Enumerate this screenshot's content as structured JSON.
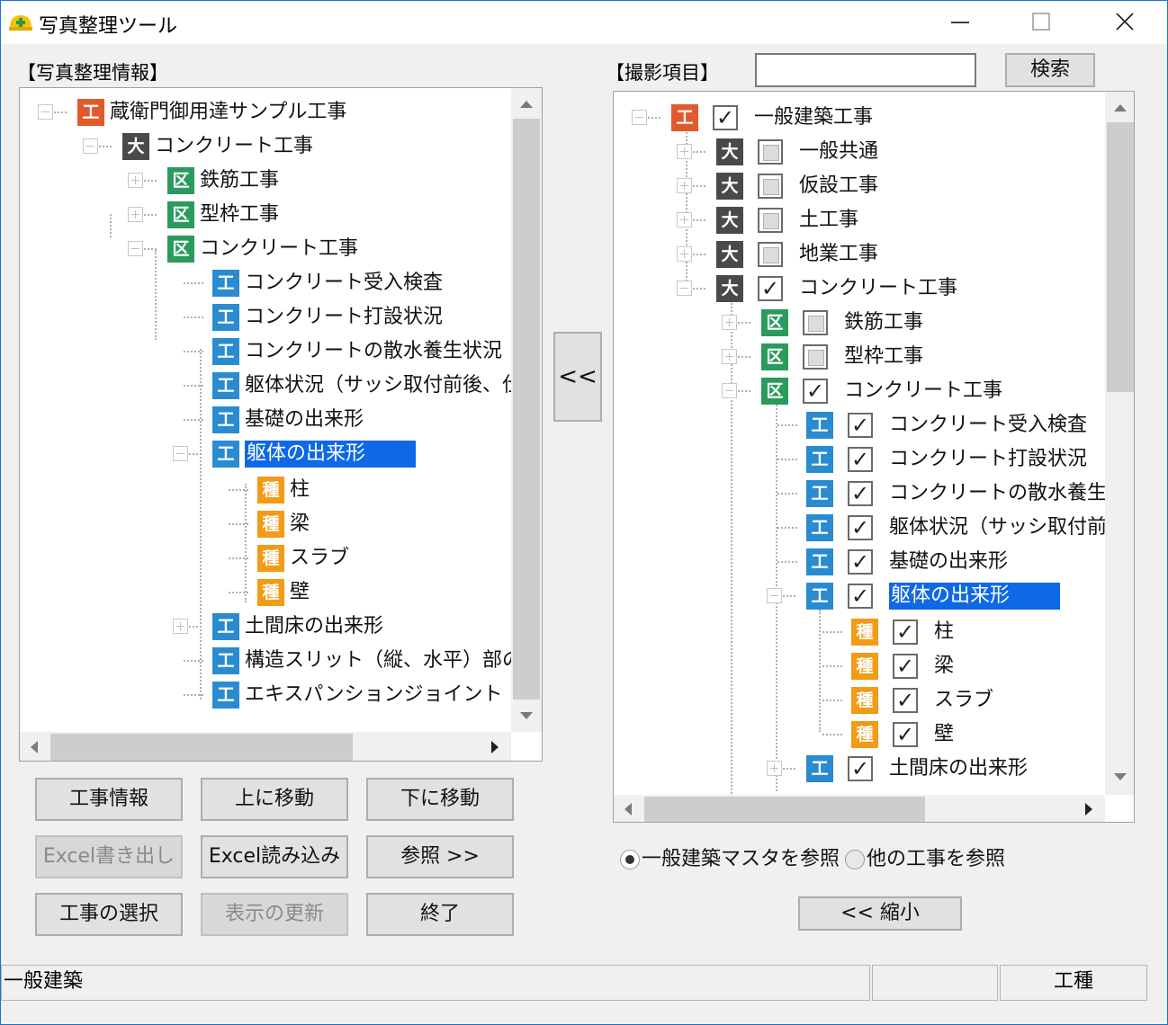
{
  "window": {
    "title": "写真整理ツール",
    "minimize": "—",
    "maximize": "☐",
    "close": "✕"
  },
  "left": {
    "label": "【写真整理情報】",
    "tree": [
      {
        "badge": "工",
        "text": "蔵衛門御用達サンプル工事"
      },
      {
        "badge": "大",
        "text": "コンクリート工事"
      },
      {
        "badge": "区",
        "text": "鉄筋工事"
      },
      {
        "badge": "区",
        "text": "型枠工事"
      },
      {
        "badge": "区",
        "text": "コンクリート工事"
      },
      {
        "badge": "工",
        "text": "コンクリート受入検査"
      },
      {
        "badge": "工",
        "text": "コンクリート打設状況"
      },
      {
        "badge": "工",
        "text": "コンクリートの散水養生状況"
      },
      {
        "badge": "工",
        "text": "躯体状況（サッシ取付前後、仕"
      },
      {
        "badge": "工",
        "text": "基礎の出来形"
      },
      {
        "badge": "工",
        "text": "躯体の出来形"
      },
      {
        "badge": "種",
        "text": "柱"
      },
      {
        "badge": "種",
        "text": "梁"
      },
      {
        "badge": "種",
        "text": "スラブ"
      },
      {
        "badge": "種",
        "text": "壁"
      },
      {
        "badge": "工",
        "text": "土間床の出来形"
      },
      {
        "badge": "工",
        "text": "構造スリット（縦、水平）部の確"
      },
      {
        "badge": "工",
        "text": "エキスパンションジョイント"
      }
    ]
  },
  "middle": {
    "move_left": "<<"
  },
  "buttons": {
    "project_info": "工事情報",
    "move_up": "上に移動",
    "move_down": "下に移動",
    "excel_export": "Excel書き出し",
    "excel_import": "Excel読み込み",
    "browse": "参照 >>",
    "select_project": "工事の選択",
    "refresh": "表示の更新",
    "exit": "終了"
  },
  "right": {
    "label": "【撮影項目】",
    "search_value": "",
    "search_button": "検索",
    "tree": [
      {
        "badge": "工",
        "text": "一般建築工事",
        "checked": true
      },
      {
        "badge": "大",
        "text": "一般共通",
        "checked": false
      },
      {
        "badge": "大",
        "text": "仮設工事",
        "checked": false
      },
      {
        "badge": "大",
        "text": "土工事",
        "checked": false
      },
      {
        "badge": "大",
        "text": "地業工事",
        "checked": false
      },
      {
        "badge": "大",
        "text": "コンクリート工事",
        "checked": true
      },
      {
        "badge": "区",
        "text": "鉄筋工事",
        "checked": false
      },
      {
        "badge": "区",
        "text": "型枠工事",
        "checked": false
      },
      {
        "badge": "区",
        "text": "コンクリート工事",
        "checked": true
      },
      {
        "badge": "工",
        "text": "コンクリート受入検査",
        "checked": true
      },
      {
        "badge": "工",
        "text": "コンクリート打設状況",
        "checked": true
      },
      {
        "badge": "工",
        "text": "コンクリートの散水養生状況",
        "checked": true
      },
      {
        "badge": "工",
        "text": "躯体状況（サッシ取付前後",
        "checked": true
      },
      {
        "badge": "工",
        "text": "基礎の出来形",
        "checked": true
      },
      {
        "badge": "工",
        "text": "躯体の出来形",
        "checked": true
      },
      {
        "badge": "種",
        "text": "柱",
        "checked": true
      },
      {
        "badge": "種",
        "text": "梁",
        "checked": true
      },
      {
        "badge": "種",
        "text": "スラブ",
        "checked": true
      },
      {
        "badge": "種",
        "text": "壁",
        "checked": true
      },
      {
        "badge": "工",
        "text": "土間床の出来形",
        "checked": true
      }
    ],
    "radio_master": "一般建築マスタを参照",
    "radio_other": "他の工事を参照",
    "shrink_button": "<< 縮小"
  },
  "status": {
    "left": "一般建築",
    "middle": "",
    "right": "工種"
  },
  "colors": {
    "selection": "#0f68e6",
    "badge_ko": "#e25a2c",
    "badge_dai": "#4a4a4a",
    "badge_ku": "#2b9a5d",
    "badge_kou": "#2a8bd0",
    "badge_shu": "#f39a16"
  }
}
